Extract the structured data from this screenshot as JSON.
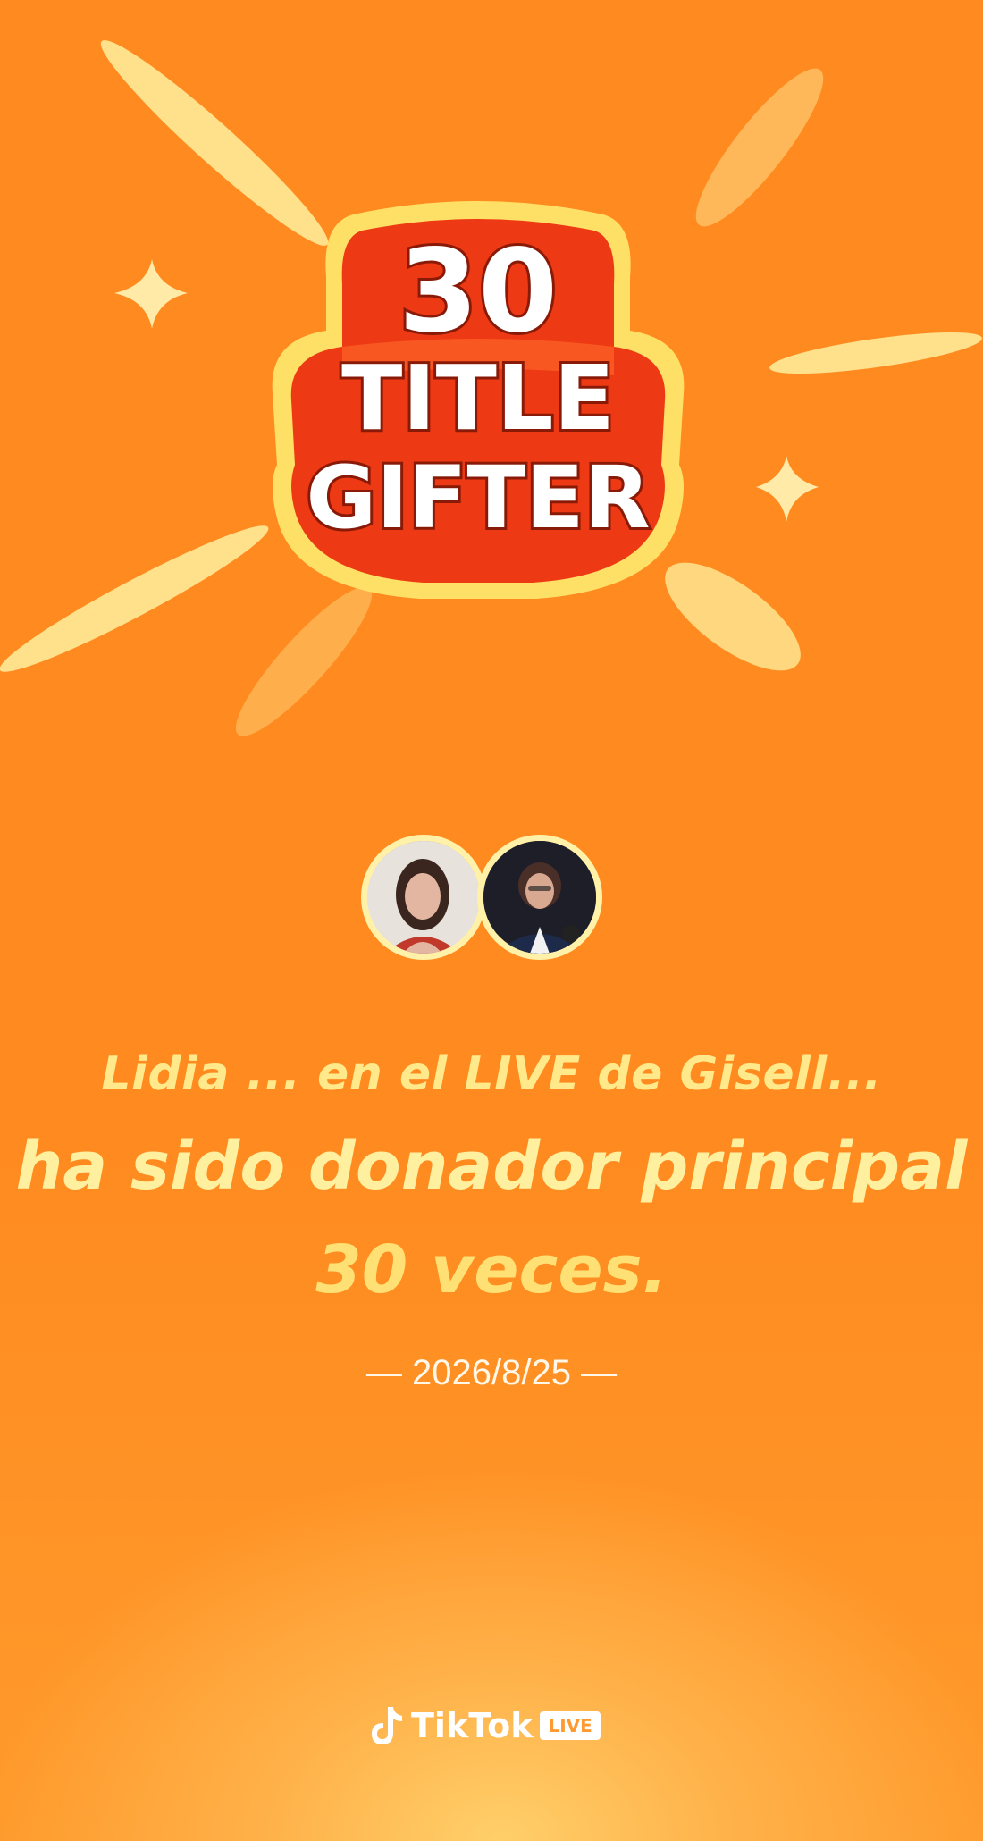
{
  "badge": {
    "number": "30",
    "line1": "TITLE",
    "line2": "GIFTER"
  },
  "avatars": [
    {
      "name": "gifter-avatar",
      "description": "Gifter profile photo"
    },
    {
      "name": "host-avatar",
      "description": "Host profile photo"
    }
  ],
  "message": {
    "line1": "Lidia ... en el LIVE de Gisell...",
    "line2": "ha sido donador principal",
    "line3": "30 veces."
  },
  "date": "— 2026/8/25 —",
  "brand": {
    "name": "TikTok",
    "live_tag": "LIVE"
  },
  "colors": {
    "background": "#ff8a1f",
    "text_yellow": "#ffe98a",
    "badge_red": "#ee3a14",
    "badge_outline": "#ffe066"
  }
}
